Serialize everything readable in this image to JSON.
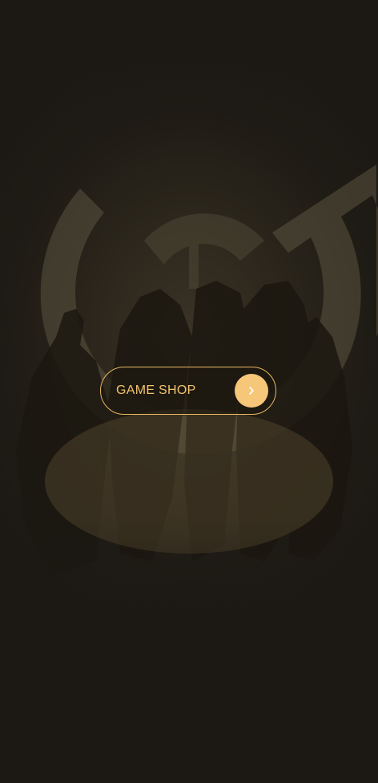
{
  "shop_button": {
    "label": "GAME SHOP",
    "icon": "chevron-right-icon"
  },
  "colors": {
    "accent": "#f2c46e",
    "accent_fill": "#f6c679",
    "background": "#1c1813"
  }
}
